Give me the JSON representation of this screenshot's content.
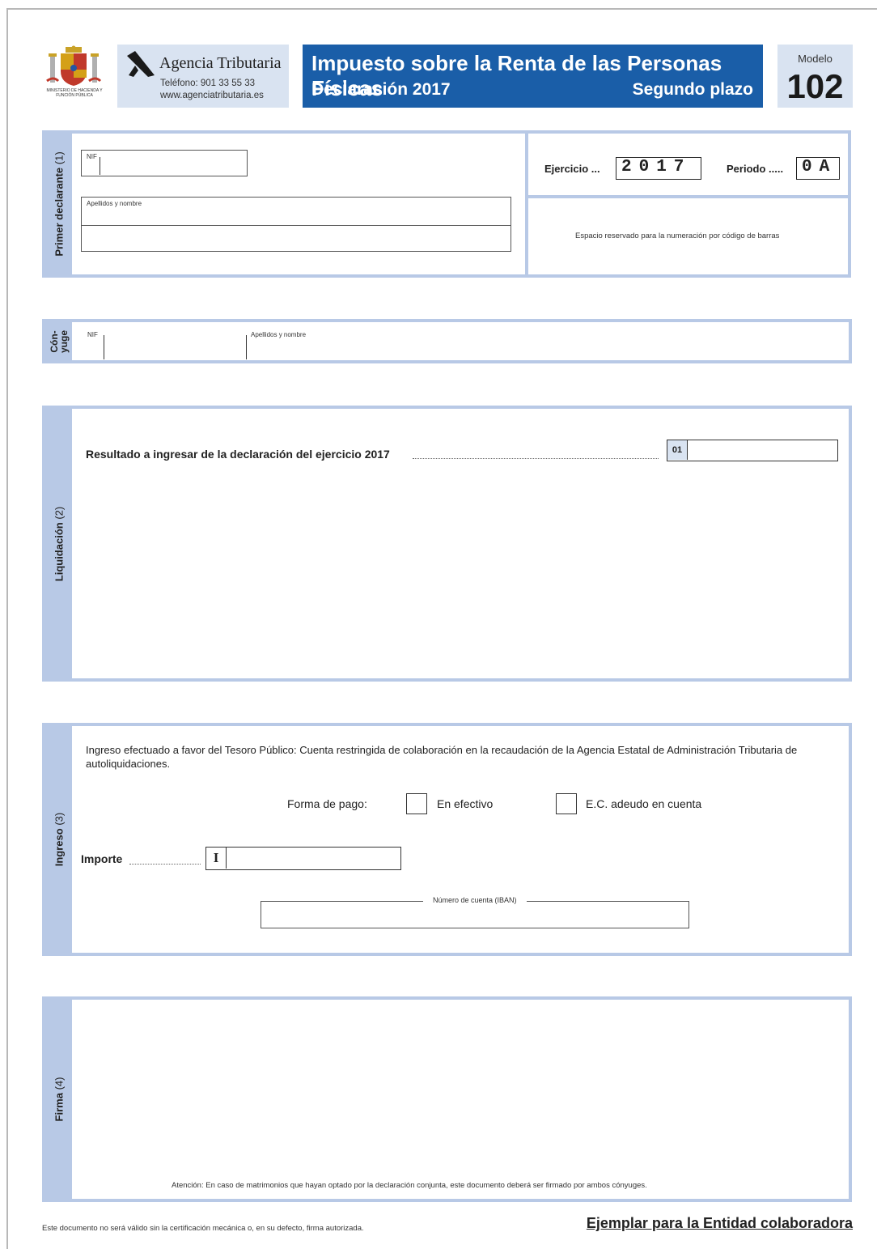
{
  "header": {
    "ministry_text": "MINISTERIO DE HACIENDA Y FUNCIÓN PÚBLICA",
    "agency_name": "Agencia Tributaria",
    "agency_phone": "Teléfono: 901 33 55 33",
    "agency_web": "www.agenciatributaria.es",
    "title_main": "Impuesto sobre la Renta de las Personas Físicas",
    "title_declaration": "Declaración 2017",
    "title_plazo": "Segundo plazo",
    "modelo_label": "Modelo",
    "modelo_number": "102"
  },
  "primer_declarante": {
    "section_label": "Primer declarante",
    "section_num": "(1)",
    "nif_label": "NIF",
    "name_label": "Apellidos y nombre",
    "ejercicio_label": "Ejercicio ...",
    "ejercicio_value": "2017",
    "periodo_label": "Periodo .....",
    "periodo_value": "0A",
    "barcode_note": "Espacio reservado para la numeración por código de barras"
  },
  "conyuge": {
    "section_label_1": "Cón-",
    "section_label_2": "yuge",
    "nif_label": "NIF",
    "name_label": "Apellidos y nombre"
  },
  "liquidacion": {
    "section_label": "Liquidación",
    "section_num": "(2)",
    "result_label": "Resultado a ingresar de la declaración del ejercicio 2017",
    "box_code": "01"
  },
  "ingreso": {
    "section_label": "Ingreso",
    "section_num": "(3)",
    "description": "Ingreso efectuado a favor del Tesoro Público: Cuenta restringida de colaboración en la recaudación de la Agencia Estatal de Administración Tributaria de autoliquidaciones.",
    "forma_pago_label": "Forma de pago:",
    "option_efectivo": "En efectivo",
    "option_adeudo": "E.C. adeudo en cuenta",
    "importe_label": "Importe",
    "importe_prefix": "I",
    "iban_label": "Número de cuenta (IBAN)"
  },
  "firma": {
    "section_label": "Firma",
    "section_num": "(4)",
    "note": "Atención: En caso de matrimonios que hayan optado por la declaración conjunta, este documento deberá ser firmado por ambos cónyuges."
  },
  "footer": {
    "validity_note": "Este documento no será válido sin la certificación mecánica o, en su defecto, firma autorizada.",
    "copy_label": "Ejemplar para la Entidad colaboradora"
  },
  "colors": {
    "primary_blue": "#1a5ea8",
    "light_blue": "#d9e3f1",
    "section_border": "#b8c9e6"
  }
}
